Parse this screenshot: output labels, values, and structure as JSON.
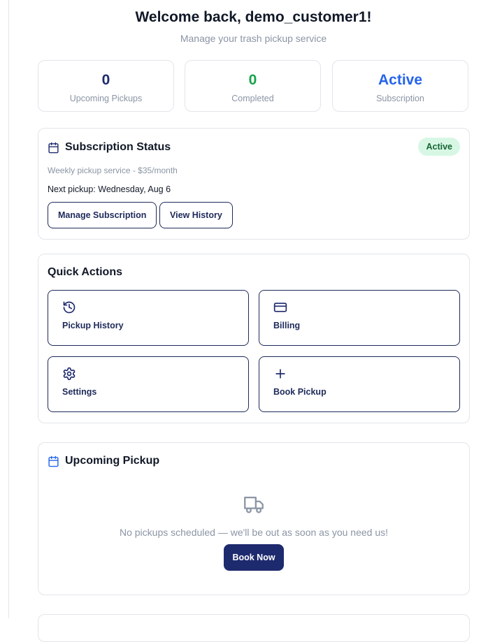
{
  "header": {
    "welcome": "Welcome back, demo_customer1!",
    "subtitle": "Manage your trash pickup service"
  },
  "stats": [
    {
      "value": "0",
      "label": "Upcoming Pickups",
      "color": "#1e2a6e"
    },
    {
      "value": "0",
      "label": "Completed",
      "color": "#16a34a"
    },
    {
      "value": "Active",
      "label": "Subscription",
      "color": "#2563eb"
    }
  ],
  "subscription": {
    "title": "Subscription Status",
    "icon": "calendar-icon",
    "badge": "Active",
    "description": "Weekly pickup service - $35/month",
    "next_pickup": "Next pickup: Wednesday, Aug 6",
    "manage_label": "Manage Subscription",
    "history_label": "View History"
  },
  "quick_actions": {
    "title": "Quick Actions",
    "items": [
      {
        "label": "Pickup History",
        "icon": "history-icon"
      },
      {
        "label": "Billing",
        "icon": "credit-card-icon"
      },
      {
        "label": "Settings",
        "icon": "gear-icon"
      },
      {
        "label": "Book Pickup",
        "icon": "plus-icon"
      }
    ]
  },
  "upcoming": {
    "title": "Upcoming Pickup",
    "icon": "calendar-icon",
    "empty_icon": "truck-icon",
    "empty_text": "No pickups scheduled — we'll be out as soon as you need us!",
    "book_label": "Book Now"
  },
  "colors": {
    "navy": "#1e2a6e",
    "green": "#16a34a",
    "blue": "#2563eb",
    "badge_bg": "#d7f7e4"
  }
}
